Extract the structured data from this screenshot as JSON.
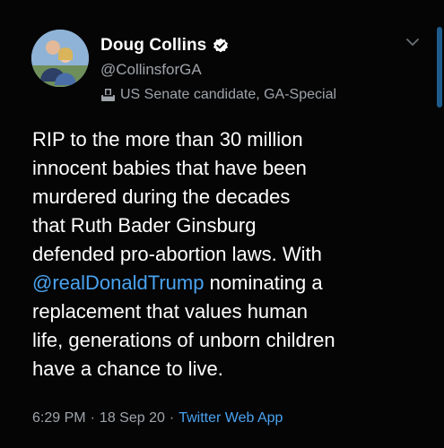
{
  "author": {
    "display_name": "Doug Collins",
    "handle": "@CollinsforGA",
    "label": "US Senate candidate, GA-Special"
  },
  "tweet": {
    "lines": [
      {
        "text": "RIP to the more than 30 million"
      },
      {
        "text": "innocent babies that have been"
      },
      {
        "text": "murdered during the decades"
      },
      {
        "text": "that Ruth Bader Ginsburg"
      },
      {
        "text": "defended pro-abortion laws. With"
      },
      {
        "mention": "@realDonaldTrump",
        "text": " nominating a"
      },
      {
        "text": "replacement that values human"
      },
      {
        "text": "life, generations of unborn children"
      },
      {
        "text": "have a chance to live."
      }
    ]
  },
  "meta": {
    "time": "6:29 PM",
    "separator": "·",
    "date": "18 Sep 20",
    "source": "Twitter Web App"
  },
  "colors": {
    "background": "#050505",
    "link": "#4aa3f0",
    "secondary_text": "#9ea4aa"
  },
  "icons": {
    "verified": "verified-badge-icon",
    "label": "ballot-box-icon",
    "menu": "chevron-down-icon"
  }
}
